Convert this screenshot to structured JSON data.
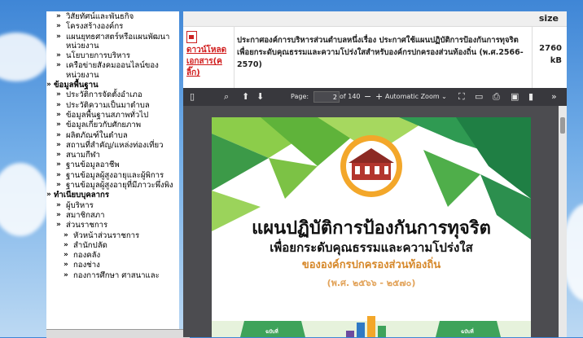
{
  "sidebar": {
    "items": [
      {
        "level": 2,
        "label": "วิสัยทัศน์และพันธกิจ"
      },
      {
        "level": 2,
        "label": "โครงสร้างองค์กร"
      },
      {
        "level": 2,
        "label": "แผนยุทธศาสตร์หรือแผนพัฒนาหน่วยงาน"
      },
      {
        "level": 2,
        "label": "นโยบายการบริหาร"
      },
      {
        "level": 2,
        "label": "เครือข่ายสังคมออนไลน์ของหน่วยงาน"
      },
      {
        "level": 1,
        "label": "ข้อมูลพื้นฐาน"
      },
      {
        "level": 2,
        "label": "ประวัติการจัดตั้งอำเภอ"
      },
      {
        "level": 2,
        "label": "ประวัติความเป็นมาตำบล"
      },
      {
        "level": 2,
        "label": "ข้อมูลพื้นฐานสภาพทั่วไป"
      },
      {
        "level": 2,
        "label": "ข้อมูลเกี่ยวกับศักยภาพ"
      },
      {
        "level": 2,
        "label": "ผลิตภัณฑ์ในตำบล"
      },
      {
        "level": 2,
        "label": "สถานที่สำคัญ/แหล่งท่องเที่ยว"
      },
      {
        "level": 2,
        "label": "สนามกีฬา"
      },
      {
        "level": 2,
        "label": "ฐานข้อมูลอาชีพ"
      },
      {
        "level": 2,
        "label": "ฐานข้อมูลผู้สูงอายุและผู้พิการ"
      },
      {
        "level": 2,
        "label": "ฐานข้อมูลผู้สูงอายุที่มีภาวะพึ่งพิง"
      },
      {
        "level": 1,
        "label": "ทำเนียบบุคลากร"
      },
      {
        "level": 2,
        "label": "ผู้บริหาร"
      },
      {
        "level": 2,
        "label": "สมาชิกสภา"
      },
      {
        "level": 2,
        "label": "ส่วนราชการ"
      },
      {
        "level": 3,
        "label": "หัวหน้าส่วนราชการ"
      },
      {
        "level": 3,
        "label": "สำนักปลัด"
      },
      {
        "level": 3,
        "label": "กองคลัง"
      },
      {
        "level": 3,
        "label": "กองช่าง"
      },
      {
        "level": 3,
        "label": "กองการศึกษา ศาสนาและ"
      }
    ]
  },
  "table": {
    "size_header": "size",
    "row": {
      "download_label": "ดาวน์โหลดเอกสาร(คลิ๊ก)",
      "description": "ประกาศองค์การบริหารส่วนตำบลหนึ่งเรื่อง ประกาศใช้แผนปฏิบัติการป้องกันการทุจริต เพื่อยกระดับคุณธรรมและความโปร่งใสสำหรับองค์กรปกครองส่วนท้องถิ่น (พ.ศ.2566-2570)",
      "size": "2760 kB"
    }
  },
  "viewer": {
    "page_label": "Page:",
    "page_number": "2",
    "page_total": "of 140",
    "zoom_label": "Automatic Zoom",
    "cover": {
      "line1": "แผนปฏิบัติการป้องกันการทุจริต",
      "line2": "เพื่อยกระดับคุณธรรมและความโปร่งใส",
      "line3": "ขององค์กรปกครองส่วนท้องถิ่น",
      "line4": "(พ.ศ. ๒๕๖๖ - ๒๕๗๐)",
      "badge_left": "ฉบับที่",
      "badge_right": "ฉบับที่"
    }
  },
  "colors": {
    "download_red": "#d01a1a",
    "cover_green": "#6cbf3a",
    "cover_orange": "#d6882a",
    "toolbar_bg": "#38383d"
  }
}
